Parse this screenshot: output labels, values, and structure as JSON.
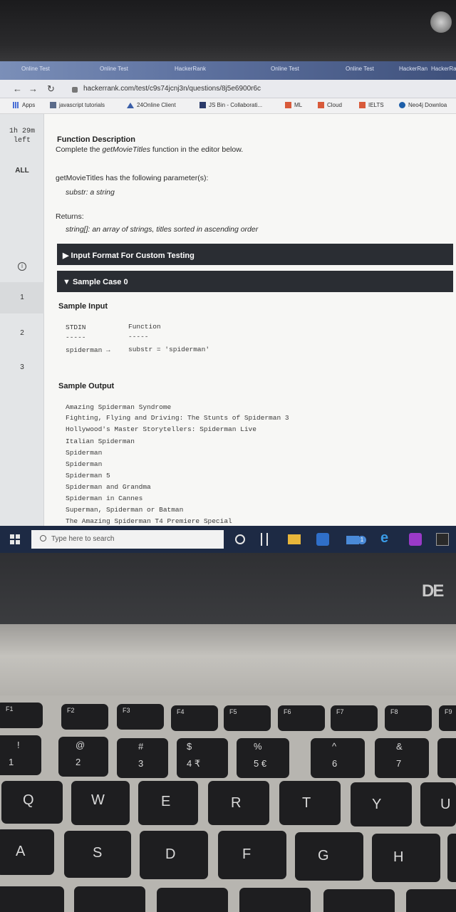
{
  "browser": {
    "tabs": [
      "Online Test",
      "Online Test",
      "HackerRank",
      "Online Test",
      "Online Test",
      "HackerRank",
      "HackerRank"
    ],
    "url": "hackerrank.com/test/c9s74jcnj3n/questions/8j5e6900r6c",
    "bookmarks": [
      {
        "label": "Apps",
        "icon": "grid-icon",
        "color": "#4a6fd6"
      },
      {
        "label": "javascript tutorials",
        "icon": "folder-icon",
        "color": "#5b6b8a"
      },
      {
        "label": "24Online Client",
        "icon": "triangle-icon",
        "color": "#3a5ea8"
      },
      {
        "label": "JS Bin - Collaborati...",
        "icon": "jsbin-icon",
        "color": "#2a3a6a"
      },
      {
        "label": "ML",
        "icon": "folder-icon",
        "color": "#d85a3a"
      },
      {
        "label": "Cloud",
        "icon": "folder-icon",
        "color": "#d85a3a"
      },
      {
        "label": "IELTS",
        "icon": "folder-icon",
        "color": "#d85a3a"
      },
      {
        "label": "Neo4j Downloa",
        "icon": "neo4j-icon",
        "color": "#1d5ea8"
      }
    ]
  },
  "sidebar": {
    "timer_line1": "1h 29m",
    "timer_line2": "left",
    "all_label": "ALL",
    "items": [
      "1",
      "2",
      "3"
    ]
  },
  "content": {
    "section_title": "Function Description",
    "desc_pre": "Complete the ",
    "desc_func": "getMovieTitles",
    "desc_post": " function in the editor below.",
    "params_intro": "getMovieTitles has the following parameter(s):",
    "param1": "substr: a string",
    "returns_label": "Returns:",
    "returns_text": "string[]: an array of strings, titles sorted in ascending order",
    "input_format_bar": "▶ Input Format For Custom Testing",
    "sample_case_bar": "▼ Sample Case 0",
    "sample_input_label": "Sample Input",
    "stdin_header": "STDIN",
    "function_header": "Function",
    "stdin_sep": "-----",
    "function_sep": "-----",
    "stdin_value": "spiderman →",
    "function_value": "substr = 'spiderman'",
    "sample_output_label": "Sample Output",
    "output_lines": [
      "Amazing Spiderman Syndrome",
      "Fighting, Flying and Driving: The Stunts of Spiderman 3",
      "Hollywood's Master Storytellers: Spiderman Live",
      "Italian Spiderman",
      "Spiderman",
      "Spiderman",
      "Spiderman 5",
      "Spiderman and Grandma",
      "Spiderman in Cannes",
      "Superman, Spiderman or Batman",
      "The Amazing Spiderman T4 Premiere Special"
    ]
  },
  "taskbar": {
    "search_placeholder": "Type here to search",
    "mail_badge": "1"
  },
  "laptop": {
    "brand": "DE",
    "fkeys": [
      "F1",
      "F2",
      "F3",
      "F4",
      "F5",
      "F6",
      "F7",
      "F8",
      "F9"
    ],
    "number_row": [
      {
        "top": "!",
        "bottom": "1"
      },
      {
        "top": "@",
        "bottom": "2"
      },
      {
        "top": "#",
        "bottom": "3"
      },
      {
        "top": "$",
        "bottom": "4 ₹"
      },
      {
        "top": "%",
        "bottom": "5 €"
      },
      {
        "top": "^",
        "bottom": "6"
      },
      {
        "top": "&",
        "bottom": "7"
      }
    ],
    "qwerty_row": [
      "Q",
      "W",
      "E",
      "R",
      "T",
      "Y",
      "U"
    ],
    "asdf_row": [
      "A",
      "S",
      "D",
      "F",
      "G",
      "H"
    ]
  }
}
